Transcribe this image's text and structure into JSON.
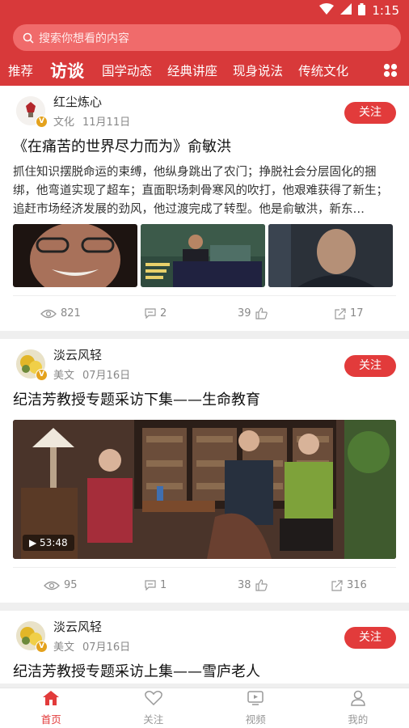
{
  "status_bar": {
    "time": "1:15"
  },
  "search": {
    "placeholder": "搜索你想看的内容"
  },
  "tabs": [
    {
      "label": "推荐"
    },
    {
      "label": "访谈",
      "active": true
    },
    {
      "label": "国学动态"
    },
    {
      "label": "经典讲座"
    },
    {
      "label": "现身说法"
    },
    {
      "label": "传统文化"
    }
  ],
  "colors": {
    "brand_red": "#d8393a",
    "follow_red": "#e23b3b"
  },
  "feed": [
    {
      "author": "红尘炼心",
      "category": "文化",
      "date": "11月11日",
      "follow_label": "关注",
      "title": "《在痛苦的世界尽力而为》俞敏洪",
      "summary": "抓住知识摆脱命运的束缚，他纵身跳出了农门；挣脱社会分层固化的捆绑，他弯道实现了超车；直面职场刺骨寒风的吹打，他艰难获得了新生；追赶市场经济发展的劲风，他过渡完成了转型。他是俞敏洪，新东…",
      "views": "821",
      "comments": "2",
      "likes": "39",
      "shares": "17"
    },
    {
      "author": "淡云风轻",
      "category": "美文",
      "date": "07月16日",
      "follow_label": "关注",
      "title": "纪洁芳教授专题采访下集——生命教育",
      "video_duration": "53:48",
      "views": "95",
      "comments": "1",
      "likes": "38",
      "shares": "316"
    },
    {
      "author": "淡云风轻",
      "category": "美文",
      "date": "07月16日",
      "follow_label": "关注",
      "title": "纪洁芳教授专题采访上集——雪庐老人"
    }
  ],
  "bottom_nav": [
    {
      "label": "首页",
      "icon": "home-icon",
      "active": true
    },
    {
      "label": "关注",
      "icon": "heart-icon"
    },
    {
      "label": "视频",
      "icon": "tv-icon"
    },
    {
      "label": "我的",
      "icon": "user-icon"
    }
  ]
}
